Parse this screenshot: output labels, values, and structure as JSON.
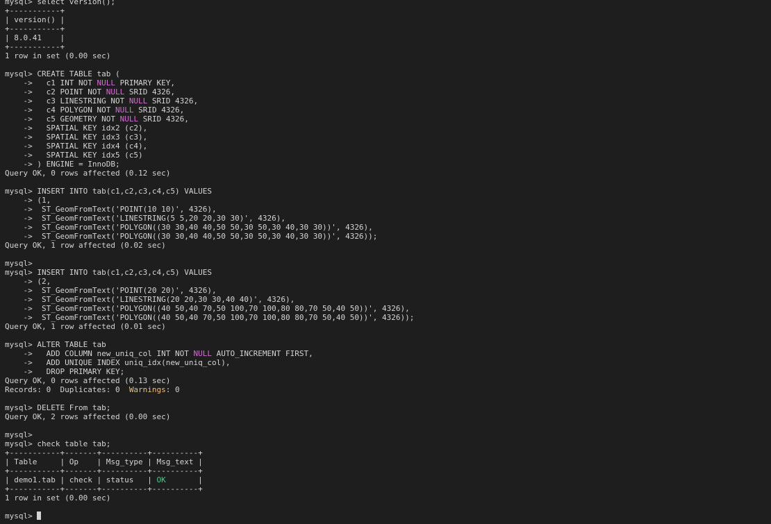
{
  "terminal": {
    "colors": {
      "background": "#1e1e1e",
      "text": "#d4d4d4",
      "keyword": "#d76ad7",
      "warning": "#e5c07b",
      "ok": "#3fd07a"
    },
    "lines": [
      [
        {
          "t": "mysql> select version();"
        }
      ],
      [
        {
          "t": "+-----------+"
        }
      ],
      [
        {
          "t": "| version() |"
        }
      ],
      [
        {
          "t": "+-----------+"
        }
      ],
      [
        {
          "t": "| 8.0.41    |"
        }
      ],
      [
        {
          "t": "+-----------+"
        }
      ],
      [
        {
          "t": "1 row in set (0.00 sec)"
        }
      ],
      [
        {
          "t": ""
        }
      ],
      [
        {
          "t": "mysql> CREATE TABLE tab ("
        }
      ],
      [
        {
          "t": "    ->   c1 INT NOT "
        },
        {
          "t": "NULL",
          "c": "kw"
        },
        {
          "t": " PRIMARY KEY,"
        }
      ],
      [
        {
          "t": "    ->   c2 POINT NOT "
        },
        {
          "t": "NULL",
          "c": "kw"
        },
        {
          "t": " SRID 4326,"
        }
      ],
      [
        {
          "t": "    ->   c3 LINESTRING NOT "
        },
        {
          "t": "NULL",
          "c": "kw"
        },
        {
          "t": " SRID 4326,"
        }
      ],
      [
        {
          "t": "    ->   c4 POLYGON NOT "
        },
        {
          "t": "NULL",
          "c": "kw"
        },
        {
          "t": " SRID 4326,"
        }
      ],
      [
        {
          "t": "    ->   c5 GEOMETRY NOT "
        },
        {
          "t": "NULL",
          "c": "kw"
        },
        {
          "t": " SRID 4326,"
        }
      ],
      [
        {
          "t": "    ->   SPATIAL KEY idx2 (c2),"
        }
      ],
      [
        {
          "t": "    ->   SPATIAL KEY idx3 (c3),"
        }
      ],
      [
        {
          "t": "    ->   SPATIAL KEY idx4 (c4),"
        }
      ],
      [
        {
          "t": "    ->   SPATIAL KEY idx5 (c5)"
        }
      ],
      [
        {
          "t": "    -> ) ENGINE = InnoDB;"
        }
      ],
      [
        {
          "t": "Query OK, 0 rows affected (0.12 sec)"
        }
      ],
      [
        {
          "t": ""
        }
      ],
      [
        {
          "t": "mysql> INSERT INTO tab(c1,c2,c3,c4,c5) VALUES"
        }
      ],
      [
        {
          "t": "    -> (1,"
        }
      ],
      [
        {
          "t": "    ->  ST_GeomFromText('POINT(10 10)', 4326),"
        }
      ],
      [
        {
          "t": "    ->  ST_GeomFromText('LINESTRING(5 5,20 20,30 30)', 4326),"
        }
      ],
      [
        {
          "t": "    ->  ST_GeomFromText('POLYGON((30 30,40 40,50 50,30 50,30 40,30 30))', 4326),"
        }
      ],
      [
        {
          "t": "    ->  ST_GeomFromText('POLYGON((30 30,40 40,50 50,30 50,30 40,30 30))', 4326));"
        }
      ],
      [
        {
          "t": "Query OK, 1 row affected (0.02 sec)"
        }
      ],
      [
        {
          "t": ""
        }
      ],
      [
        {
          "t": "mysql>"
        }
      ],
      [
        {
          "t": "mysql> INSERT INTO tab(c1,c2,c3,c4,c5) VALUES"
        }
      ],
      [
        {
          "t": "    -> (2,"
        }
      ],
      [
        {
          "t": "    ->  ST_GeomFromText('POINT(20 20)', 4326),"
        }
      ],
      [
        {
          "t": "    ->  ST_GeomFromText('LINESTRING(20 20,30 30,40 40)', 4326),"
        }
      ],
      [
        {
          "t": "    ->  ST_GeomFromText('POLYGON((40 50,40 70,50 100,70 100,80 80,70 50,40 50))', 4326),"
        }
      ],
      [
        {
          "t": "    ->  ST_GeomFromText('POLYGON((40 50,40 70,50 100,70 100,80 80,70 50,40 50))', 4326));"
        }
      ],
      [
        {
          "t": "Query OK, 1 row affected (0.01 sec)"
        }
      ],
      [
        {
          "t": ""
        }
      ],
      [
        {
          "t": "mysql> ALTER TABLE tab"
        }
      ],
      [
        {
          "t": "    ->   ADD COLUMN new_uniq_col INT NOT "
        },
        {
          "t": "NULL",
          "c": "kw"
        },
        {
          "t": " AUTO_INCREMENT FIRST,"
        }
      ],
      [
        {
          "t": "    ->   ADD UNIQUE INDEX uniq_idx(new_uniq_col),"
        }
      ],
      [
        {
          "t": "    ->   DROP PRIMARY KEY;"
        }
      ],
      [
        {
          "t": "Query OK, 0 rows affected (0.13 sec)"
        }
      ],
      [
        {
          "t": "Records: 0  Duplicates: 0  "
        },
        {
          "t": "Warnings",
          "c": "warn"
        },
        {
          "t": ": 0"
        }
      ],
      [
        {
          "t": ""
        }
      ],
      [
        {
          "t": "mysql> DELETE From tab;"
        }
      ],
      [
        {
          "t": "Query OK, 2 rows affected (0.00 sec)"
        }
      ],
      [
        {
          "t": ""
        }
      ],
      [
        {
          "t": "mysql>"
        }
      ],
      [
        {
          "t": "mysql> check table tab;"
        }
      ],
      [
        {
          "t": "+-----------+-------+----------+----------+"
        }
      ],
      [
        {
          "t": "| Table     | Op    | Msg_type | Msg_text |"
        }
      ],
      [
        {
          "t": "+-----------+-------+----------+----------+"
        }
      ],
      [
        {
          "t": "| demo1.tab | check | status   | "
        },
        {
          "t": "OK",
          "c": "ok"
        },
        {
          "t": "       |"
        }
      ],
      [
        {
          "t": "+-----------+-------+----------+----------+"
        }
      ],
      [
        {
          "t": "1 row in set (0.00 sec)"
        }
      ],
      [
        {
          "t": ""
        }
      ],
      [
        {
          "t": "mysql> "
        }
      ]
    ]
  }
}
